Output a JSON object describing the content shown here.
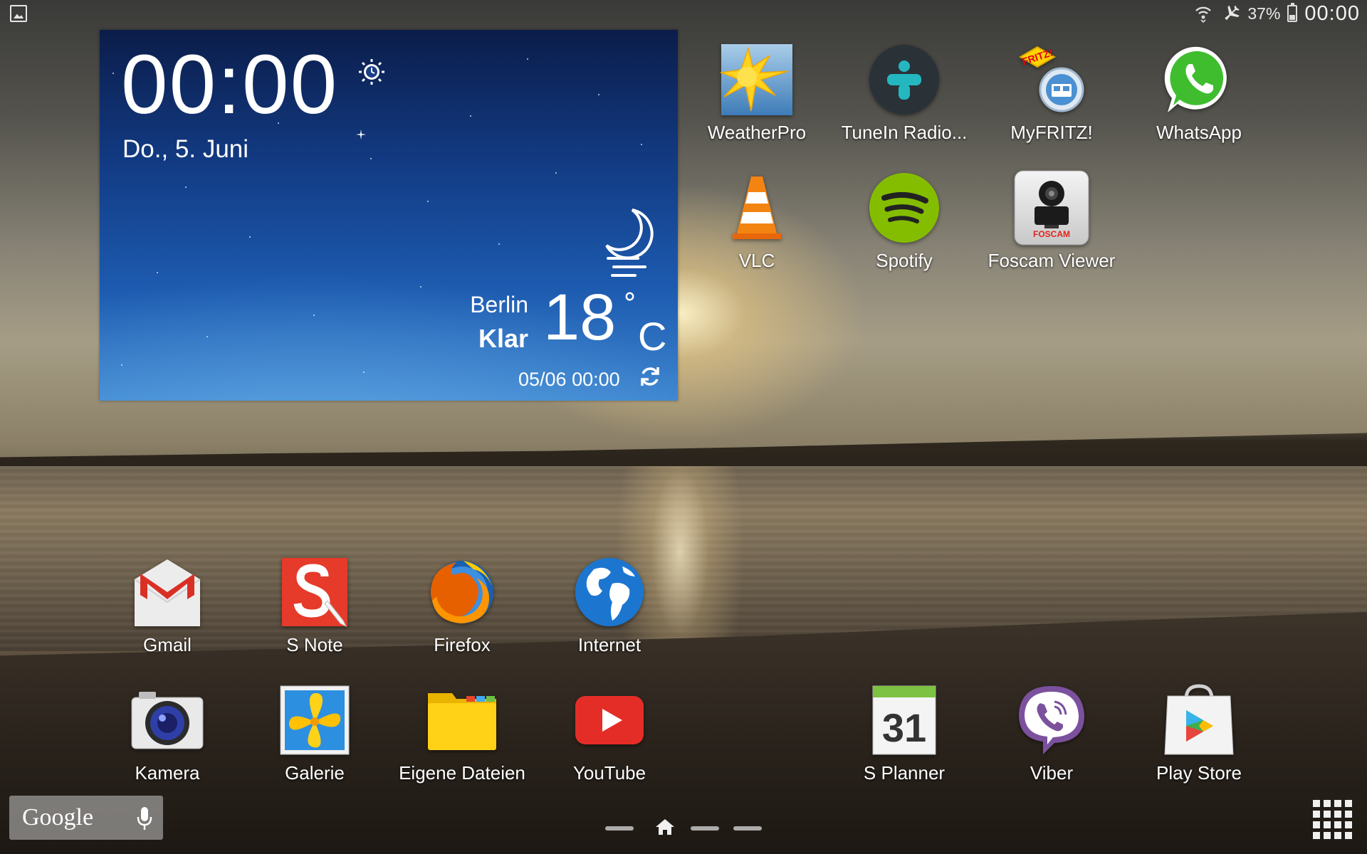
{
  "status_bar": {
    "battery_percent": "37%",
    "clock": "00:00",
    "icons": [
      "gallery-notification-icon",
      "wifi-icon",
      "airplane-mode-icon",
      "battery-icon"
    ]
  },
  "weather_widget": {
    "time": "00:00",
    "date": "Do., 5. Juni",
    "city": "Berlin",
    "condition": "Klar",
    "temperature": "18",
    "degree_symbol": "°",
    "unit": "C",
    "updated": "05/06 00:00",
    "icons": [
      "alarm-icon",
      "moon-clear-night-icon",
      "refresh-icon"
    ]
  },
  "apps_top": [
    {
      "label": "WeatherPro",
      "icon": "weatherpro-icon"
    },
    {
      "label": "TuneIn Radio...",
      "icon": "tunein-icon"
    },
    {
      "label": "MyFRITZ!",
      "icon": "myfritz-icon"
    },
    {
      "label": "WhatsApp",
      "icon": "whatsapp-icon"
    },
    {
      "label": "VLC",
      "icon": "vlc-icon"
    },
    {
      "label": "Spotify",
      "icon": "spotify-icon"
    },
    {
      "label": "Foscam Viewer",
      "icon": "foscam-icon"
    }
  ],
  "apps_bottom": [
    {
      "label": "Gmail",
      "icon": "gmail-icon"
    },
    {
      "label": "S Note",
      "icon": "snote-icon"
    },
    {
      "label": "Firefox",
      "icon": "firefox-icon"
    },
    {
      "label": "Internet",
      "icon": "internet-globe-icon"
    },
    {
      "label": "Kamera",
      "icon": "camera-icon"
    },
    {
      "label": "Galerie",
      "icon": "gallery-icon"
    },
    {
      "label": "Eigene Dateien",
      "icon": "folder-icon"
    },
    {
      "label": "YouTube",
      "icon": "youtube-icon"
    },
    {
      "label": "S Planner",
      "icon": "calendar-icon"
    },
    {
      "label": "Viber",
      "icon": "viber-icon"
    },
    {
      "label": "Play Store",
      "icon": "play-store-icon"
    }
  ],
  "icon_text": {
    "myfritz_badge": "FRITZ!",
    "foscam_brand": "FOSCAM",
    "calendar_day": "31"
  },
  "google_search": {
    "logo_text": "Google"
  },
  "pager": {
    "page_count": 4,
    "current": "home"
  },
  "colors": {
    "widget_sky_top": "#0b1d4a",
    "widget_sky_bottom": "#3e86d0",
    "spotify_green": "#84bd00",
    "whatsapp_green": "#3fbd2f",
    "youtube_red": "#e52d27",
    "viber_purple": "#7b519d"
  }
}
